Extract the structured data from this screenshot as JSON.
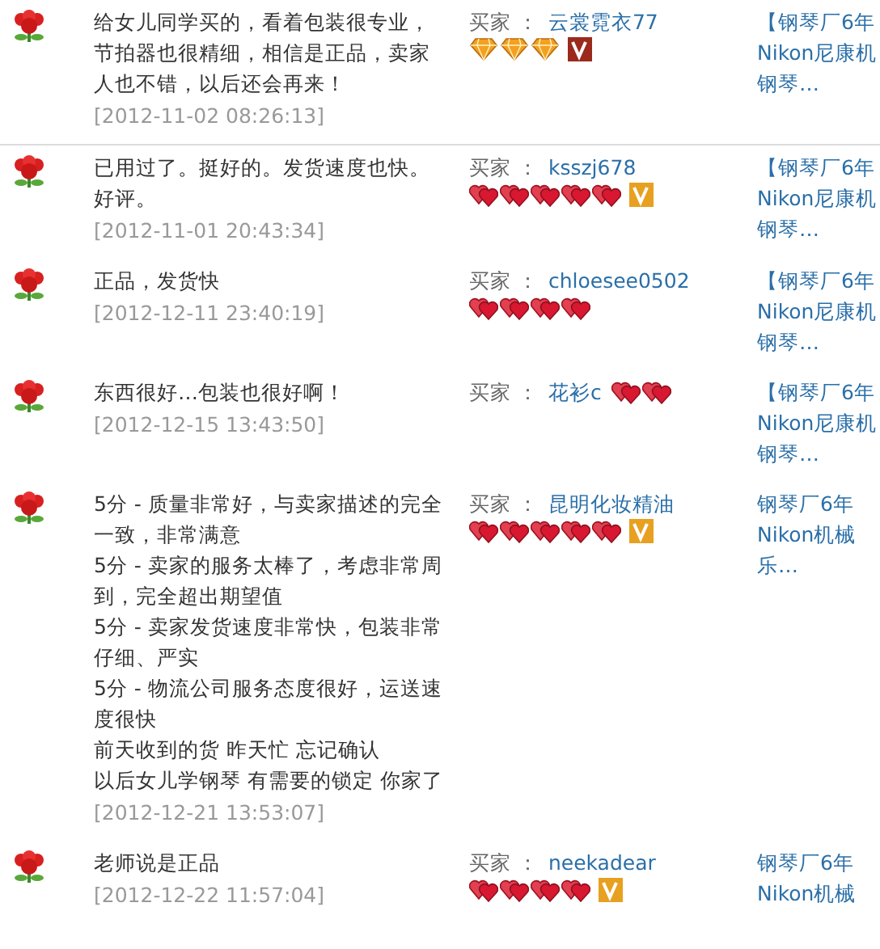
{
  "reviews": [
    {
      "comment": [
        "给女儿同学买的，看着包装很专业，节拍器也很精细，相信是正品，卖家人也不错，以后还会再来！"
      ],
      "date": "[2012-11-02 08:26:13]",
      "buyer_label": "买家 ：",
      "buyer": "云裳霓衣77",
      "rank_icons": [
        {
          "kind": "diamond"
        },
        {
          "kind": "diamond"
        },
        {
          "kind": "diamond"
        }
      ],
      "vip_badge": {
        "color": "#9b2a1c"
      },
      "product_lines": [
        "【钢琴厂6年",
        "Nikon尼康机",
        "钢琴…"
      ]
    },
    {
      "comment": [
        "已用过了。挺好的。发货速度也快。好评。"
      ],
      "date": "[2012-11-01 20:43:34]",
      "buyer_label": "买家 ：",
      "buyer": "ksszj678",
      "rank_icons": [
        {
          "kind": "heart"
        },
        {
          "kind": "heart"
        },
        {
          "kind": "heart"
        },
        {
          "kind": "heart"
        },
        {
          "kind": "heart"
        }
      ],
      "vip_badge": {
        "color": "#e8a020"
      },
      "product_lines": [
        "【钢琴厂6年",
        "Nikon尼康机",
        "钢琴…"
      ]
    },
    {
      "comment": [
        "正品，发货快"
      ],
      "date": "[2012-12-11 23:40:19]",
      "buyer_label": "买家 ：",
      "buyer": "chloesee0502",
      "rank_icons": [
        {
          "kind": "heart"
        },
        {
          "kind": "heart"
        },
        {
          "kind": "heart"
        },
        {
          "kind": "heart"
        }
      ],
      "product_lines": [
        "【钢琴厂6年",
        "Nikon尼康机",
        "钢琴…"
      ]
    },
    {
      "comment": [
        "东西很好…包装也很好啊！"
      ],
      "date": "[2012-12-15 13:43:50]",
      "buyer_label": "买家 ：",
      "buyer": "花衫c",
      "rank_icons": [
        {
          "kind": "heart"
        },
        {
          "kind": "heart"
        }
      ],
      "product_lines": [
        "【钢琴厂6年",
        "Nikon尼康机",
        "钢琴…"
      ]
    },
    {
      "comment": [
        "5分 - 质量非常好，与卖家描述的完全一致，非常满意",
        "5分 - 卖家的服务太棒了，考虑非常周到，完全超出期望值",
        "5分 - 卖家发货速度非常快，包装非常仔细、严实",
        "5分 - 物流公司服务态度很好，运送速度很快",
        "前天收到的货 昨天忙 忘记确认",
        "以后女儿学钢琴 有需要的锁定 你家了"
      ],
      "date": "[2012-12-21 13:53:07]",
      "buyer_label": "买家 ：",
      "buyer": "昆明化妆精油",
      "rank_icons": [
        {
          "kind": "heart"
        },
        {
          "kind": "heart"
        },
        {
          "kind": "heart"
        },
        {
          "kind": "heart"
        },
        {
          "kind": "heart"
        }
      ],
      "vip_badge": {
        "color": "#e8a020"
      },
      "product_lines": [
        "钢琴厂6年",
        "Nikon机械",
        "乐…"
      ]
    },
    {
      "comment": [
        "老师说是正品"
      ],
      "date": "[2012-12-22 11:57:04]",
      "buyer_label": "买家 ：",
      "buyer": "neekadear",
      "rank_icons": [
        {
          "kind": "heart"
        },
        {
          "kind": "heart"
        },
        {
          "kind": "heart"
        },
        {
          "kind": "heart"
        }
      ],
      "vip_badge": {
        "color": "#e8a020"
      },
      "product_lines": [
        "钢琴厂6年",
        "Nikon机械"
      ]
    }
  ]
}
